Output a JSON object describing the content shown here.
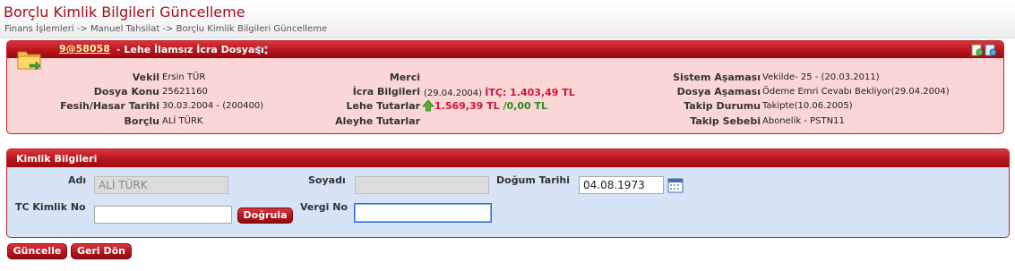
{
  "page": {
    "title": "Borçlu Kimlik Bilgileri Güncelleme",
    "breadcrumb": "Finans İşlemleri -> Manuel Tahsilat -> Borçlu Kimlik Bilgileri Güncelleme"
  },
  "file": {
    "link": "9@58058",
    "description": "- Lehe İlamsız İcra Dosyası",
    "fields": {
      "vekil_label": "Vekil",
      "vekil_value": "Ersin TÜR",
      "dosya_konu_label": "Dosya Konu",
      "dosya_konu_value": "25621160",
      "fesih_label": "Fesih/Hasar Tarihi",
      "fesih_value": "30.03.2004 - (200400)",
      "borclu_label": "Borçlu",
      "borclu_value": "ALİ TÜRK",
      "merci_label": "Merci",
      "merci_value": "",
      "icra_label": "İcra Bilgileri",
      "icra_date": "(29.04.2004)",
      "icra_itc": "İTÇ: 1.403,49 TL",
      "lehe_label": "Lehe Tutarlar",
      "lehe_amount": "1.569,39 TL",
      "lehe_sep": " /",
      "lehe_second": "0,00 TL",
      "aleyhe_label": "Aleyhe Tutarlar",
      "aleyhe_value": "",
      "sistem_label": "Sistem Aşaması",
      "sistem_value": "Vekilde- 25 - (20.03.2011)",
      "dosya_asama_label": "Dosya Aşaması",
      "dosya_asama_value": "Ödeme Emri Cevabı Bekliyor(29.04.2004)",
      "takip_durumu_label": "Takip Durumu",
      "takip_durumu_value": "Takipte(10.06.2005)",
      "takip_sebebi_label": "Takip Sebebi",
      "takip_sebebi_value": "Abonelik - PSTN11"
    }
  },
  "kimlik": {
    "title": "Kimlik Bilgileri",
    "adi_label": "Adı",
    "adi_value": "ALİ TÜRK",
    "soyadi_label": "Soyadı",
    "soyadi_value": "",
    "dogum_label": "Doğum Tarihi",
    "dogum_value": "04.08.1973",
    "tc_label": "TC Kimlik No",
    "tc_value": "",
    "dogrula_button": "Doğrula",
    "vergi_label": "Vergi No",
    "vergi_value": ""
  },
  "actions": {
    "guncelle": "Güncelle",
    "geri_don": "Geri Dön"
  },
  "colors": {
    "title_red": "#a30e17",
    "header_red": "#b7141b",
    "panel_pink": "#fbd6d6",
    "panel_blue": "#d6e4f5",
    "amount_red": "#d1133c",
    "amount_green": "#2d8a1d"
  }
}
